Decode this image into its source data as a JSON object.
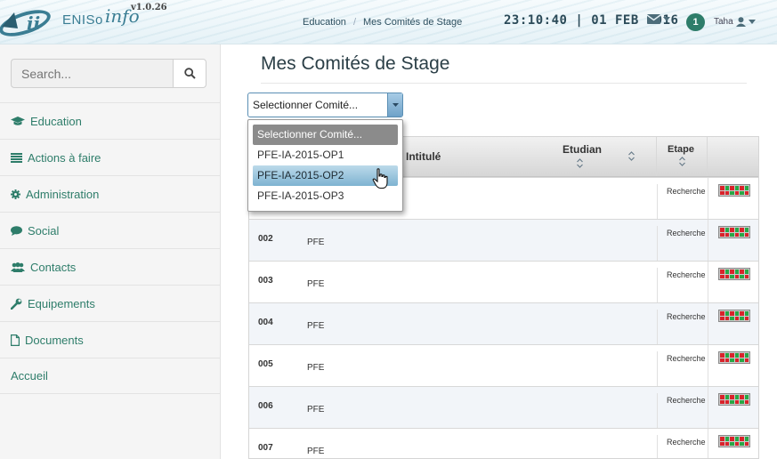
{
  "app": {
    "logo_text": "ENISo",
    "logo_script": "info",
    "version": "v1.0.26"
  },
  "header": {
    "breadcrumb": [
      "Education",
      "Mes Comités de Stage"
    ],
    "clock": "23:10:40 | 01 FEB 2016",
    "notifications_count": "1",
    "user_name": "Taha"
  },
  "sidebar": {
    "search_placeholder": "Search...",
    "items": [
      {
        "label": "Education",
        "icon": "graduation-cap-icon"
      },
      {
        "label": "Actions à faire",
        "icon": "list-icon"
      },
      {
        "label": "Administration",
        "icon": "gear-icon"
      },
      {
        "label": "Social",
        "icon": "comment-icon"
      },
      {
        "label": "Contacts",
        "icon": "users-icon"
      },
      {
        "label": "Equipements",
        "icon": "wrench-icon"
      },
      {
        "label": "Documents",
        "icon": "file-icon"
      },
      {
        "label": "Accueil",
        "icon": ""
      }
    ]
  },
  "main": {
    "title": "Mes Comités de Stage",
    "select": {
      "value": "Selectionner Comité...",
      "options": [
        "Selectionner Comité...",
        "PFE-IA-2015-OP1",
        "PFE-IA-2015-OP2",
        "PFE-IA-2015-OP3"
      ],
      "highlighted": "PFE-IA-2015-OP2"
    },
    "table": {
      "headers": {
        "intitule": "Intitulé",
        "etudiant": "Etudian",
        "etape": "Etape"
      },
      "rows": [
        {
          "id": "",
          "title": "",
          "etape": "Recherche PFE"
        },
        {
          "id": "002",
          "title": "PFE",
          "etape": "Recherche PFE"
        },
        {
          "id": "003",
          "title": "PFE",
          "etape": "Recherche PFE"
        },
        {
          "id": "004",
          "title": "PFE",
          "etape": "Recherche PFE"
        },
        {
          "id": "005",
          "title": "PFE",
          "etape": "Recherche PFE"
        },
        {
          "id": "006",
          "title": "PFE",
          "etape": "Recherche PFE"
        },
        {
          "id": "007",
          "title": "PFE",
          "etape": "Recherche PFE"
        }
      ]
    }
  },
  "colors": {
    "accent": "#2e7d6a",
    "status_red": "#d9232b",
    "status_green": "#28a745",
    "select_border": "#5b8fb4"
  }
}
